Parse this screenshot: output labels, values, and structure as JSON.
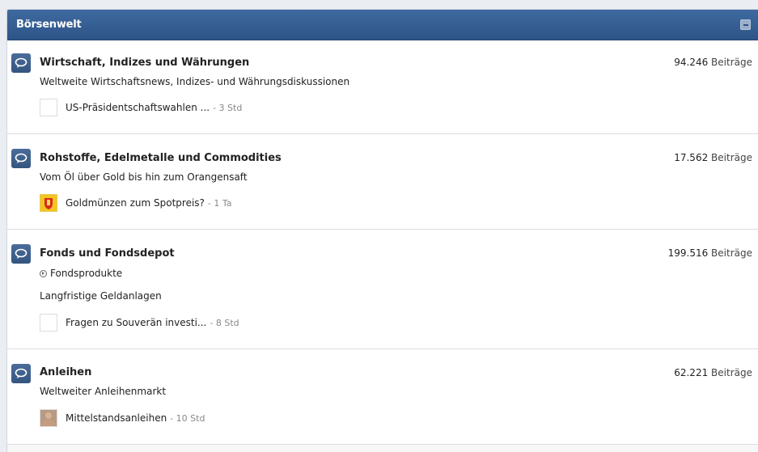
{
  "category": {
    "title": "Börsenwelt"
  },
  "forums": [
    {
      "title": "Wirtschaft, Indizes und Währungen",
      "description": "Weltweite Wirtschaftsnews, Indizes- und Währungsdiskussionen",
      "posts_count": "94.246",
      "posts_label": "Beiträge",
      "last_post_title": "US-Präsidentschaftswahlen ...",
      "last_post_time": "- 3 Std",
      "avatar": "blank"
    },
    {
      "title": "Rohstoffe, Edelmetalle und Commodities",
      "description": "Vom Öl über Gold bis hin zum Orangensaft",
      "posts_count": "17.562",
      "posts_label": "Beiträge",
      "last_post_title": "Goldmünzen zum Spotpreis?",
      "last_post_time": "- 1 Ta",
      "avatar": "coat-of-arms"
    },
    {
      "title": "Fonds und Fondsdepot",
      "subforum": "Fondsprodukte",
      "description": "Langfristige Geldanlagen",
      "posts_count": "199.516",
      "posts_label": "Beiträge",
      "last_post_title": "Fragen zu Souverän investi...",
      "last_post_time": "- 8 Std",
      "avatar": "blank"
    },
    {
      "title": "Anleihen",
      "description": "Weltweiter Anleihenmarkt",
      "posts_count": "62.221",
      "posts_label": "Beiträge",
      "last_post_title": "Mittelstandsanleihen",
      "last_post_time": "- 10 Std",
      "avatar": "person-photo"
    }
  ]
}
